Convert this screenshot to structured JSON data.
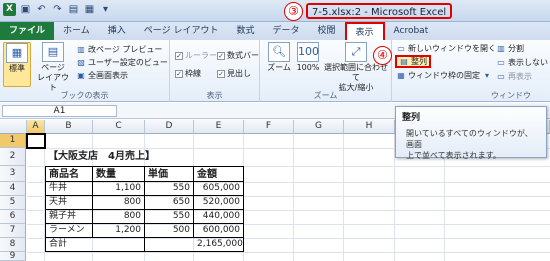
{
  "window": {
    "title": "7-5.xlsx:2 - Microsoft Excel",
    "qat_icons": [
      "excel-app-icon",
      "save-icon",
      "undo-icon",
      "redo-icon",
      "open-folder-icon",
      "print-preview-icon",
      "customize-qat-icon"
    ]
  },
  "callouts": {
    "step3": "③",
    "step4": "④"
  },
  "tabs": [
    {
      "label": "ファイル"
    },
    {
      "label": "ホーム"
    },
    {
      "label": "挿入"
    },
    {
      "label": "ページ レイアウト"
    },
    {
      "label": "数式"
    },
    {
      "label": "データ"
    },
    {
      "label": "校閲"
    },
    {
      "label": "表示"
    },
    {
      "label": "Acrobat"
    }
  ],
  "ribbon": {
    "book_view": {
      "group_label": "ブックの表示",
      "normal": "標準",
      "page_layout_line1": "ページ",
      "page_layout_line2": "レイアウト",
      "page_break_preview": "改ページ プレビュー",
      "custom_views": "ユーザー設定のビュー",
      "full_screen": "全画面表示"
    },
    "show": {
      "group_label": "表示",
      "ruler": "ルーラー",
      "gridlines": "枠線",
      "formula_bar": "数式バー",
      "headings": "見出し"
    },
    "zoom": {
      "group_label": "ズーム",
      "zoom": "ズーム",
      "hundred": "100%",
      "zoom_to_selection_line1": "選択範囲に合わせて",
      "zoom_to_selection_line2": "拡大/縮小"
    },
    "window": {
      "group_label": "ウィンドウ",
      "new_window": "新しいウィンドウを開く",
      "arrange_all": "整列",
      "freeze_panes": "ウィンドウ枠の固定",
      "split": "分割",
      "hide": "表示しない",
      "unhide": "再表示"
    }
  },
  "tooltip": {
    "title": "整列",
    "body_line1": "開いているすべてのウィンドウが、画面",
    "body_line2": "上で並べて表示されます。"
  },
  "formula_bar": {
    "name_box": "A1"
  },
  "sheet": {
    "columns": [
      "A",
      "B",
      "C",
      "D",
      "E",
      "F",
      "G",
      "H",
      "I",
      "J"
    ],
    "rows": [
      "1",
      "2",
      "3",
      "4",
      "5",
      "6",
      "7",
      "8",
      "9"
    ],
    "heading": "【大阪支店　4月売上】",
    "table_header": [
      "商品名",
      "数量",
      "単価",
      "金額"
    ],
    "table_rows": [
      [
        "牛丼",
        "1,100",
        "550",
        "605,000"
      ],
      [
        "天丼",
        "800",
        "650",
        "520,000"
      ],
      [
        "親子丼",
        "800",
        "550",
        "440,000"
      ],
      [
        "ラーメン",
        "1,200",
        "500",
        "600,000"
      ]
    ],
    "total_label": "合計",
    "total_value": "2,165,000"
  }
}
